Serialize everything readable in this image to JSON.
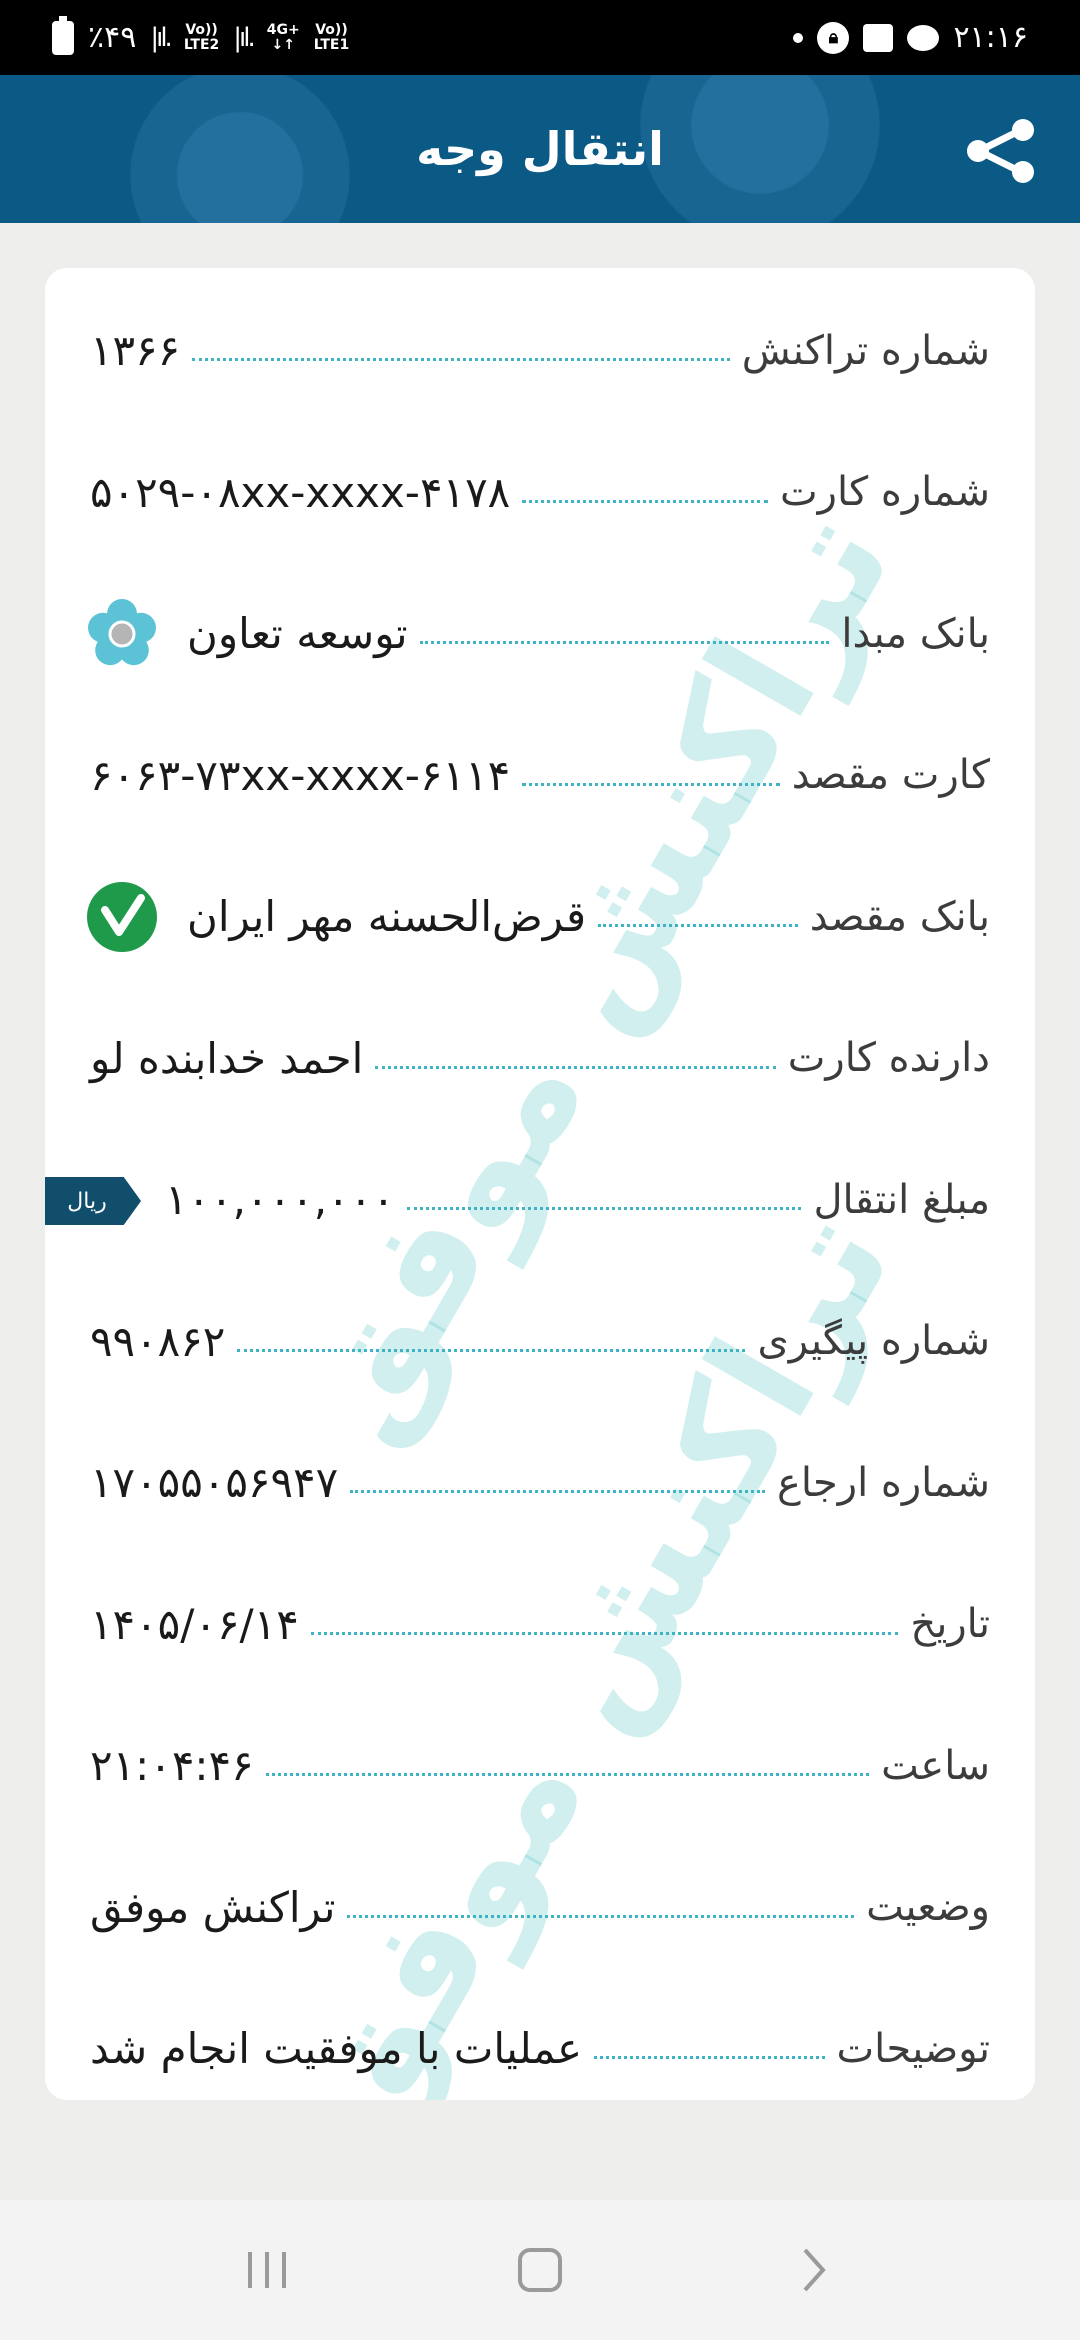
{
  "status_bar": {
    "battery": "٪۴۹",
    "sim1": "Vo))\nLTE2",
    "sim2_label": "4G+",
    "sim2": "Vo))\nLTE1",
    "time": "۲۱:۱۶"
  },
  "header": {
    "title": "انتقال وجه",
    "share_icon": "share-icon",
    "color": "#0b5a86"
  },
  "watermark": {
    "text": "تراکنش موفق",
    "color": "#58c4c4"
  },
  "receipt": {
    "rows": [
      {
        "label": "شماره تراکنش",
        "value": "۱۳۶۶"
      },
      {
        "label": "شماره کارت",
        "value": "۵۰۲۹-۰۸xx-xxxx-۴۱۷۸"
      },
      {
        "label": "بانک مبدا",
        "value": "توسعه تعاون",
        "icon": "tosee-taavon-bank-logo"
      },
      {
        "label": "کارت مقصد",
        "value": "۶۰۶۳-۷۳xx-xxxx-۶۱۱۴"
      },
      {
        "label": "بانک مقصد",
        "value": "قرض‌الحسنه مهر ایران",
        "icon": "mehr-iran-bank-logo"
      },
      {
        "label": "دارنده کارت",
        "value": "احمد خدابنده لو"
      },
      {
        "label": "مبلغ انتقال",
        "value": "۱۰۰,۰۰۰,۰۰۰",
        "currency": "ریال"
      },
      {
        "label": "شماره پیگیری",
        "value": "۹۹۰۸۶۲"
      },
      {
        "label": "شماره ارجاع",
        "value": "۱۷۰۵۵۰۵۶۹۴۷"
      },
      {
        "label": "تاریخ",
        "value": "۱۴۰۵/۰۶/۱۴"
      },
      {
        "label": "ساعت",
        "value": "۲۱:۰۴:۴۶"
      },
      {
        "label": "وضعیت",
        "value": "تراکنش موفق"
      },
      {
        "label": "توضیحات",
        "value": "عملیات با موفقیت انجام شد"
      }
    ]
  },
  "nav": {
    "recents_icon": "recents-icon",
    "home_icon": "home-icon",
    "back_icon": "back-icon"
  }
}
